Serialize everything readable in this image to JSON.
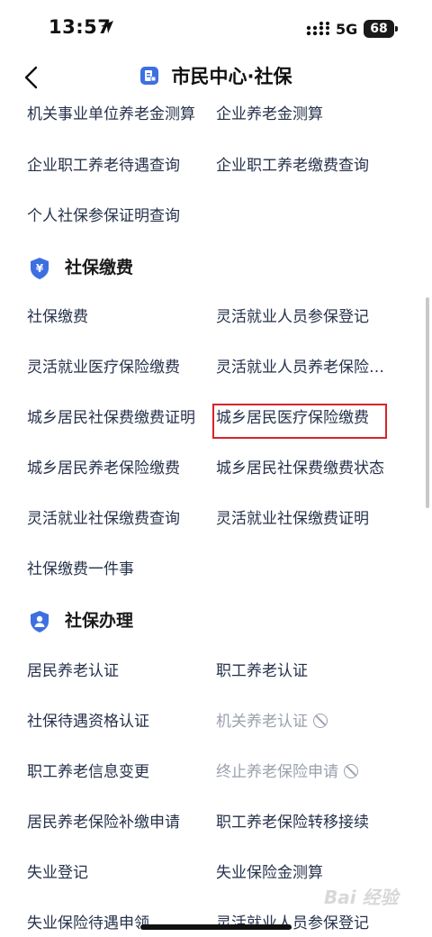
{
  "status_bar": {
    "time": "13:57",
    "network": "5G",
    "battery": "68"
  },
  "nav": {
    "title": "市民中心·社保"
  },
  "sections": {
    "top": {
      "items": [
        {
          "label": "机关事业单位养老金测算"
        },
        {
          "label": "企业养老金测算"
        },
        {
          "label": "企业职工养老待遇查询"
        },
        {
          "label": "企业职工养老缴费查询"
        },
        {
          "label": "个人社保参保证明查询"
        }
      ]
    },
    "payment": {
      "title": "社保缴费",
      "items": [
        {
          "label": "社保缴费"
        },
        {
          "label": "灵活就业人员参保登记"
        },
        {
          "label": "灵活就业医疗保险缴费"
        },
        {
          "label": "灵活就业人员养老保险缴费"
        },
        {
          "label": "城乡居民社保费缴费证明"
        },
        {
          "label": "城乡居民医疗保险缴费"
        },
        {
          "label": "城乡居民养老保险缴费"
        },
        {
          "label": "城乡居民社保费缴费状态"
        },
        {
          "label": "灵活就业社保缴费查询"
        },
        {
          "label": "灵活就业社保缴费证明"
        },
        {
          "label": "社保缴费一件事"
        }
      ]
    },
    "handling": {
      "title": "社保办理",
      "items": [
        {
          "label": "居民养老认证"
        },
        {
          "label": "职工养老认证"
        },
        {
          "label": "社保待遇资格认证"
        },
        {
          "label": "机关养老认证"
        },
        {
          "label": "职工养老信息变更"
        },
        {
          "label": "终止养老保险申请"
        },
        {
          "label": "居民养老保险补缴申请"
        },
        {
          "label": "职工养老保险转移接续"
        },
        {
          "label": "失业登记"
        },
        {
          "label": "失业保险金测算"
        },
        {
          "label": "失业保险待遇申领"
        },
        {
          "label": "灵活就业人员参保登记"
        }
      ]
    }
  },
  "colors": {
    "accent": "#3d6fe0",
    "link_text": "#26324b",
    "disabled_text": "#9aa1ad",
    "highlight": "#d9222a"
  },
  "icons": [
    "location-arrow-icon",
    "signal-icon",
    "back-chevron-icon",
    "citizen-center-icon",
    "yuan-shield-icon",
    "person-shield-icon",
    "disabled-icon"
  ],
  "watermark": "Bai 经验"
}
